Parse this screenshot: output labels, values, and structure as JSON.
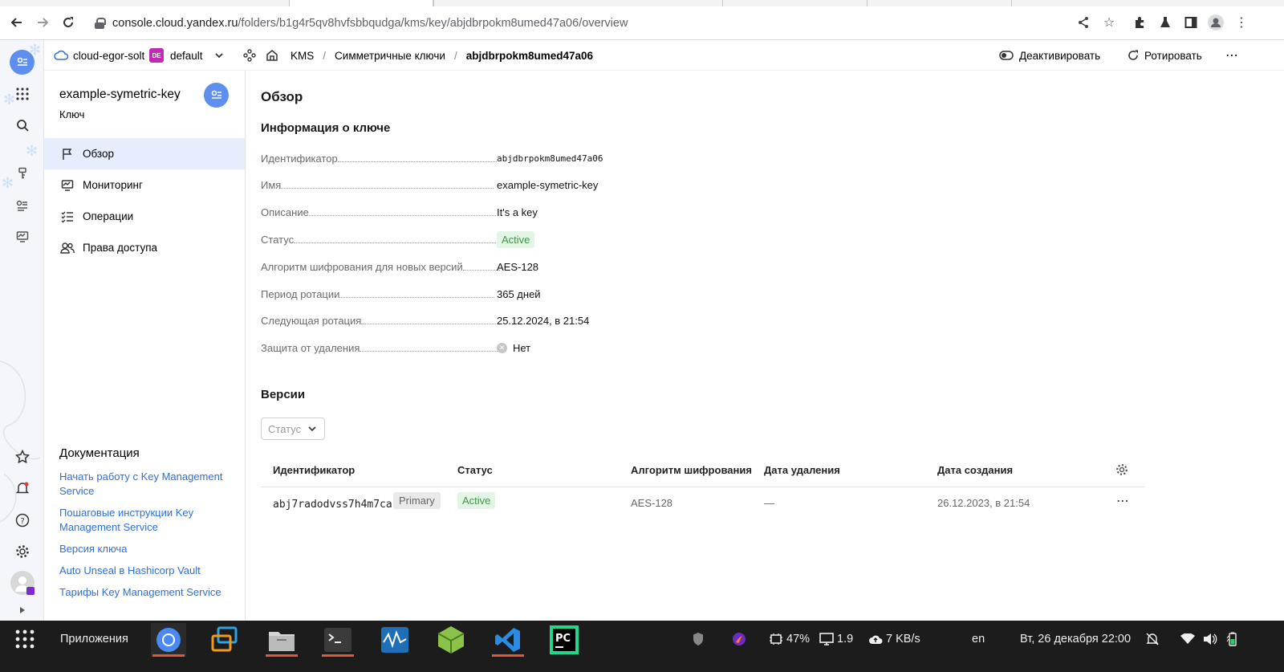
{
  "browser": {
    "url_host": "console.cloud.yandex.ru",
    "url_path": "/folders/b1g4r5qv8hvfsbbqudga/kms/key/abjdbrpokm8umed47a06/overview"
  },
  "header": {
    "cloud": "cloud-egor-solt",
    "folder_badge": "DE",
    "folder": "default",
    "breadcrumbs": [
      "KMS",
      "/",
      "Симметричные ключи",
      "/",
      "abjdbrpokm8umed47a06"
    ],
    "deactivate": "Деактивировать",
    "rotate": "Ротировать"
  },
  "side": {
    "title": "example-symetric-key",
    "subtitle": "Ключ",
    "menu": [
      {
        "label": "Обзор",
        "icon": "flag-icon"
      },
      {
        "label": "Мониторинг",
        "icon": "monitor-icon"
      },
      {
        "label": "Операции",
        "icon": "checklist-icon"
      },
      {
        "label": "Права доступа",
        "icon": "users-icon"
      }
    ],
    "doc_title": "Документация",
    "docs": [
      "Начать работу с Key Management Service",
      "Пошаговые инструкции Key Management Service",
      "Версия ключа",
      "Auto Unseal в Hashicorp Vault",
      "Тарифы Key Management Service"
    ]
  },
  "main": {
    "title": "Обзор",
    "info_title": "Информация о ключе",
    "props": [
      {
        "label": "Идентификатор",
        "value": "abjdbrpokm8umed47a06"
      },
      {
        "label": "Имя",
        "value": "example-symetric-key"
      },
      {
        "label": "Описание",
        "value": "It's a key"
      },
      {
        "label": "Статус",
        "value": "Active"
      },
      {
        "label": "Алгоритм шифрования для новых версий",
        "value": "AES-128"
      },
      {
        "label": "Период ротации",
        "value": "365 дней"
      },
      {
        "label": "Следующая ротация",
        "value": "25.12.2024, в 21:54"
      },
      {
        "label": "Защита от удаления",
        "value": "Нет"
      }
    ],
    "versions_title": "Версии",
    "filter_placeholder": "Статус",
    "table": {
      "headers": [
        "Идентификатор",
        "Статус",
        "Алгоритм шифрования",
        "Дата удаления",
        "Дата создания"
      ],
      "rows": [
        {
          "id": "abj7radodvss7h4m7car",
          "tag": "Primary",
          "status": "Active",
          "algorithm": "AES-128",
          "deleted": "—",
          "created": "26.12.2023, в 21:54"
        }
      ]
    }
  },
  "taskbar": {
    "apps_label": "Приложения",
    "battery": "47%",
    "load": "1.9",
    "net": "7 KB/s",
    "lang": "en",
    "datetime": "Вт, 26 декабря  22:00"
  }
}
